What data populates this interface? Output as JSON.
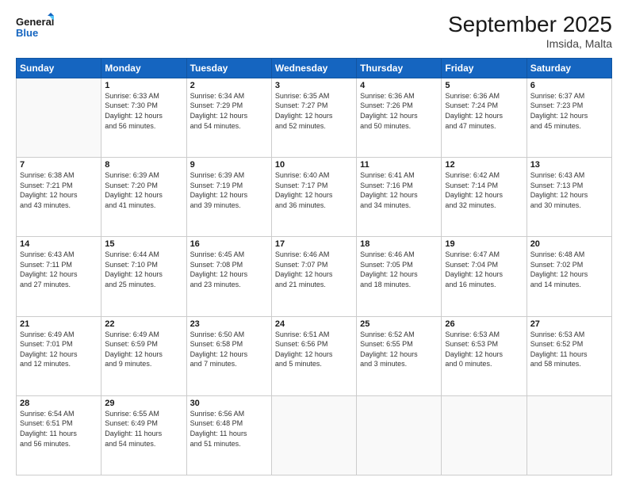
{
  "header": {
    "logo_general": "General",
    "logo_blue": "Blue",
    "month_title": "September 2025",
    "location": "Imsida, Malta"
  },
  "days_of_week": [
    "Sunday",
    "Monday",
    "Tuesday",
    "Wednesday",
    "Thursday",
    "Friday",
    "Saturday"
  ],
  "weeks": [
    [
      {
        "day": "",
        "info": ""
      },
      {
        "day": "1",
        "info": "Sunrise: 6:33 AM\nSunset: 7:30 PM\nDaylight: 12 hours\nand 56 minutes."
      },
      {
        "day": "2",
        "info": "Sunrise: 6:34 AM\nSunset: 7:29 PM\nDaylight: 12 hours\nand 54 minutes."
      },
      {
        "day": "3",
        "info": "Sunrise: 6:35 AM\nSunset: 7:27 PM\nDaylight: 12 hours\nand 52 minutes."
      },
      {
        "day": "4",
        "info": "Sunrise: 6:36 AM\nSunset: 7:26 PM\nDaylight: 12 hours\nand 50 minutes."
      },
      {
        "day": "5",
        "info": "Sunrise: 6:36 AM\nSunset: 7:24 PM\nDaylight: 12 hours\nand 47 minutes."
      },
      {
        "day": "6",
        "info": "Sunrise: 6:37 AM\nSunset: 7:23 PM\nDaylight: 12 hours\nand 45 minutes."
      }
    ],
    [
      {
        "day": "7",
        "info": "Sunrise: 6:38 AM\nSunset: 7:21 PM\nDaylight: 12 hours\nand 43 minutes."
      },
      {
        "day": "8",
        "info": "Sunrise: 6:39 AM\nSunset: 7:20 PM\nDaylight: 12 hours\nand 41 minutes."
      },
      {
        "day": "9",
        "info": "Sunrise: 6:39 AM\nSunset: 7:19 PM\nDaylight: 12 hours\nand 39 minutes."
      },
      {
        "day": "10",
        "info": "Sunrise: 6:40 AM\nSunset: 7:17 PM\nDaylight: 12 hours\nand 36 minutes."
      },
      {
        "day": "11",
        "info": "Sunrise: 6:41 AM\nSunset: 7:16 PM\nDaylight: 12 hours\nand 34 minutes."
      },
      {
        "day": "12",
        "info": "Sunrise: 6:42 AM\nSunset: 7:14 PM\nDaylight: 12 hours\nand 32 minutes."
      },
      {
        "day": "13",
        "info": "Sunrise: 6:43 AM\nSunset: 7:13 PM\nDaylight: 12 hours\nand 30 minutes."
      }
    ],
    [
      {
        "day": "14",
        "info": "Sunrise: 6:43 AM\nSunset: 7:11 PM\nDaylight: 12 hours\nand 27 minutes."
      },
      {
        "day": "15",
        "info": "Sunrise: 6:44 AM\nSunset: 7:10 PM\nDaylight: 12 hours\nand 25 minutes."
      },
      {
        "day": "16",
        "info": "Sunrise: 6:45 AM\nSunset: 7:08 PM\nDaylight: 12 hours\nand 23 minutes."
      },
      {
        "day": "17",
        "info": "Sunrise: 6:46 AM\nSunset: 7:07 PM\nDaylight: 12 hours\nand 21 minutes."
      },
      {
        "day": "18",
        "info": "Sunrise: 6:46 AM\nSunset: 7:05 PM\nDaylight: 12 hours\nand 18 minutes."
      },
      {
        "day": "19",
        "info": "Sunrise: 6:47 AM\nSunset: 7:04 PM\nDaylight: 12 hours\nand 16 minutes."
      },
      {
        "day": "20",
        "info": "Sunrise: 6:48 AM\nSunset: 7:02 PM\nDaylight: 12 hours\nand 14 minutes."
      }
    ],
    [
      {
        "day": "21",
        "info": "Sunrise: 6:49 AM\nSunset: 7:01 PM\nDaylight: 12 hours\nand 12 minutes."
      },
      {
        "day": "22",
        "info": "Sunrise: 6:49 AM\nSunset: 6:59 PM\nDaylight: 12 hours\nand 9 minutes."
      },
      {
        "day": "23",
        "info": "Sunrise: 6:50 AM\nSunset: 6:58 PM\nDaylight: 12 hours\nand 7 minutes."
      },
      {
        "day": "24",
        "info": "Sunrise: 6:51 AM\nSunset: 6:56 PM\nDaylight: 12 hours\nand 5 minutes."
      },
      {
        "day": "25",
        "info": "Sunrise: 6:52 AM\nSunset: 6:55 PM\nDaylight: 12 hours\nand 3 minutes."
      },
      {
        "day": "26",
        "info": "Sunrise: 6:53 AM\nSunset: 6:53 PM\nDaylight: 12 hours\nand 0 minutes."
      },
      {
        "day": "27",
        "info": "Sunrise: 6:53 AM\nSunset: 6:52 PM\nDaylight: 11 hours\nand 58 minutes."
      }
    ],
    [
      {
        "day": "28",
        "info": "Sunrise: 6:54 AM\nSunset: 6:51 PM\nDaylight: 11 hours\nand 56 minutes."
      },
      {
        "day": "29",
        "info": "Sunrise: 6:55 AM\nSunset: 6:49 PM\nDaylight: 11 hours\nand 54 minutes."
      },
      {
        "day": "30",
        "info": "Sunrise: 6:56 AM\nSunset: 6:48 PM\nDaylight: 11 hours\nand 51 minutes."
      },
      {
        "day": "",
        "info": ""
      },
      {
        "day": "",
        "info": ""
      },
      {
        "day": "",
        "info": ""
      },
      {
        "day": "",
        "info": ""
      }
    ]
  ]
}
